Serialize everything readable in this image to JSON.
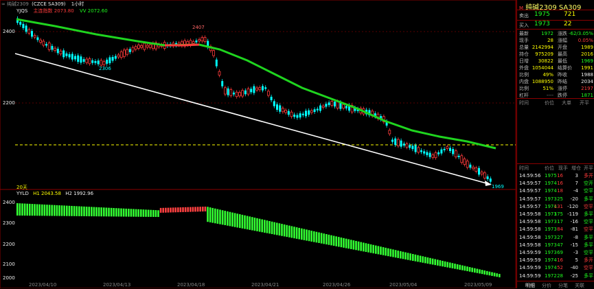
{
  "toolbar": {
    "menu_text": "∞ 纯碱2309",
    "contract_text": "(CZCE SA309)",
    "period_text": "1小时",
    "indicator_label": "YJQS",
    "indicator_v1": "主连指数 2073.80",
    "indicator_v2": "VV 2072.60"
  },
  "chart": {
    "y_axis_labels": [
      "2400",
      "2200"
    ],
    "x_axis_labels": [
      "2023/04/10",
      "2023/04/13",
      "2023/04/18",
      "2023/04/21",
      "2023/04/26",
      "2023/05/04",
      "2023/05/09"
    ],
    "annotations": {
      "high": "2407",
      "low1": "2306",
      "last": "1969"
    },
    "days_label": "20天",
    "sub_header": {
      "name": "YYLD",
      "h1": "H1 2043.58",
      "h2": "H2 1992.96"
    },
    "sub_y_labels": [
      "2400",
      "2300",
      "2200",
      "2100",
      "2000"
    ],
    "colors": {
      "up": "#ff3b3b",
      "down": "#00ffff",
      "ma": "#1fd41f",
      "trend": "#ffffff",
      "dash": "#ffff00",
      "bar_up": "#ff4040",
      "bar_down": "#33ff33"
    }
  },
  "panel": {
    "title": "纯碱2309  SA309",
    "sell": {
      "label": "卖出",
      "price": "1975",
      "vol": "721"
    },
    "buy": {
      "label": "买入",
      "price": "1973",
      "vol": "22"
    },
    "stats": [
      {
        "l1": "最新",
        "v1": "1972",
        "c1": "grn",
        "l2": "涨跌",
        "v2": "-62/3.05%",
        "c2": "grn"
      },
      {
        "l1": "现手",
        "v1": "28",
        "c1": "yel",
        "l2": "涨幅",
        "v2": "0.05%",
        "c2": "red"
      },
      {
        "l1": "总量",
        "v1": "2142994",
        "c1": "yel",
        "l2": "开盘",
        "v2": "1989",
        "c2": "yel"
      },
      {
        "l1": "持仓",
        "v1": "975209",
        "c1": "yel",
        "l2": "最高",
        "v2": "2016",
        "c2": "yel"
      },
      {
        "l1": "日增",
        "v1": "30822",
        "c1": "yel",
        "l2": "最低",
        "v2": "1969",
        "c2": "grn"
      },
      {
        "l1": "外盘",
        "v1": "1054044",
        "c1": "yel",
        "l2": "结算价",
        "v2": "1991",
        "c2": "yel"
      },
      {
        "l1": "比例",
        "v1": "49%",
        "c1": "yel",
        "l2": "昨收",
        "v2": "1988",
        "c2": "wht"
      },
      {
        "l1": "内盘",
        "v1": "1088950",
        "c1": "yel",
        "l2": "昨结",
        "v2": "2034",
        "c2": "wht"
      },
      {
        "l1": "比例",
        "v1": "51%",
        "c1": "yel",
        "l2": "涨停",
        "v2": "2197",
        "c2": "red"
      },
      {
        "l1": "杠杆",
        "v1": "----",
        "c1": "gray",
        "l2": "跌停",
        "v2": "1871",
        "c2": "grn"
      }
    ],
    "tick_header": [
      "时间",
      "价位",
      "大单",
      "开平"
    ],
    "trade_header": [
      "时间",
      "价位",
      "现手",
      "增仓",
      "开平"
    ],
    "trades": [
      {
        "t": "14:59:56",
        "p": "1975",
        "v": "16",
        "oi": "3",
        "type": "多开",
        "vc": "red",
        "tc": "red"
      },
      {
        "t": "14:59:57",
        "p": "1974",
        "v": "16",
        "oi": "7",
        "type": "空开",
        "vc": "red",
        "tc": "grn"
      },
      {
        "t": "14:59:57",
        "p": "1974",
        "v": "18",
        "oi": "-4",
        "type": "空平",
        "vc": "red",
        "tc": "grn"
      },
      {
        "t": "14:59:57",
        "p": "1973",
        "v": "25",
        "oi": "-20",
        "type": "多平",
        "vc": "grn",
        "tc": "grn"
      },
      {
        "t": "14:59:57",
        "p": "1974",
        "v": "131",
        "oi": "-120",
        "type": "空平",
        "vc": "red",
        "tc": "red"
      },
      {
        "t": "14:59:58",
        "p": "1973",
        "v": "175",
        "oi": "-119",
        "type": "多平",
        "vc": "grn",
        "tc": "grn"
      },
      {
        "t": "14:59:58",
        "p": "1973",
        "v": "17",
        "oi": "-16",
        "type": "空平",
        "vc": "grn",
        "tc": "grn"
      },
      {
        "t": "14:59:58",
        "p": "1973",
        "v": "84",
        "oi": "-81",
        "type": "空平",
        "vc": "red",
        "tc": "red"
      },
      {
        "t": "14:59:58",
        "p": "1973",
        "v": "27",
        "oi": "-8",
        "type": "多平",
        "vc": "grn",
        "tc": "grn"
      },
      {
        "t": "14:59:58",
        "p": "1973",
        "v": "47",
        "oi": "-15",
        "type": "多平",
        "vc": "grn",
        "tc": "grn"
      },
      {
        "t": "14:59:59",
        "p": "1973",
        "v": "69",
        "oi": "-3",
        "type": "空平",
        "vc": "grn",
        "tc": "grn"
      },
      {
        "t": "14:59:59",
        "p": "1974",
        "v": "16",
        "oi": "5",
        "type": "多开",
        "vc": "red",
        "tc": "red"
      },
      {
        "t": "14:59:59",
        "p": "1974",
        "v": "52",
        "oi": "-40",
        "type": "空平",
        "vc": "red",
        "tc": "red"
      },
      {
        "t": "14:59:59",
        "p": "1972",
        "v": "28",
        "oi": "-25",
        "type": "多平",
        "vc": "grn",
        "tc": "grn"
      }
    ],
    "bottom_tabs": [
      "明细",
      "分价",
      "分笔",
      "关联"
    ]
  }
}
